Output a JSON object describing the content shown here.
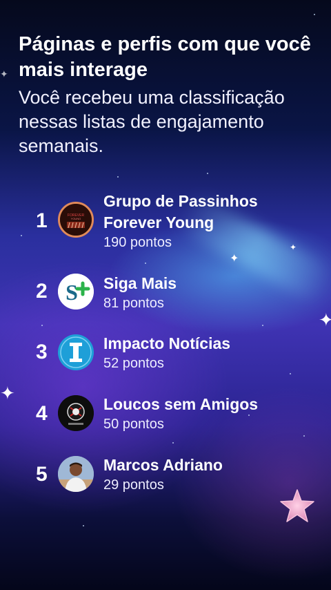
{
  "header": {
    "title": "Páginas e perfis com que você mais interage",
    "subtitle": "Você recebeu uma classificação nessas listas de engajamento semanais."
  },
  "ranking": [
    {
      "rank": "1",
      "name": "Grupo de Passinhos Forever Young",
      "points": "190 pontos",
      "avatar_icon": "forever-young-logo-icon"
    },
    {
      "rank": "2",
      "name": "Siga Mais",
      "points": "81 pontos",
      "avatar_icon": "siga-mais-logo-icon"
    },
    {
      "rank": "3",
      "name": "Impacto Notícias",
      "points": "52 pontos",
      "avatar_icon": "impacto-logo-icon"
    },
    {
      "rank": "4",
      "name": "Loucos sem Amigos",
      "points": "50 pontos",
      "avatar_icon": "corinthians-crest-icon"
    },
    {
      "rank": "5",
      "name": "Marcos Adriano",
      "points": "29 pontos",
      "avatar_icon": "profile-photo-icon"
    }
  ],
  "colors": {
    "accent_green": "#2bb34a",
    "accent_blue": "#1e9fd8",
    "background_top": "#05091c",
    "background_mid": "#3f33b3"
  }
}
